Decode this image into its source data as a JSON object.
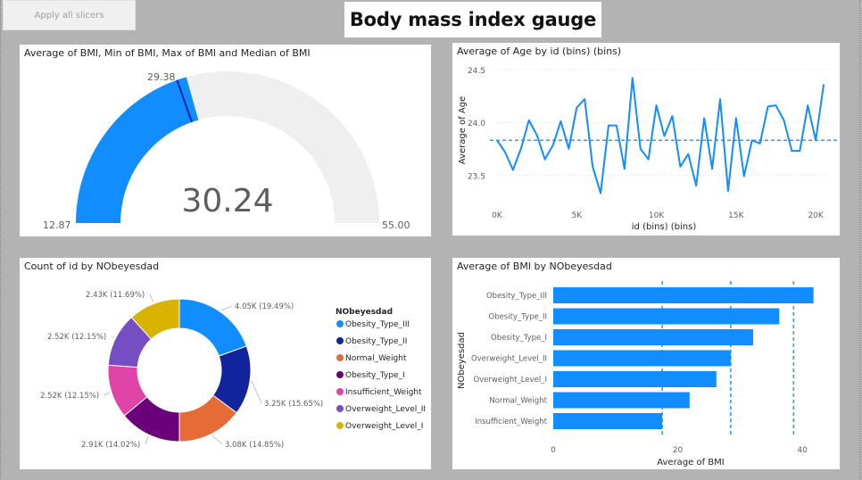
{
  "toolbar": {
    "apply_slicers_label": "Apply all slicers"
  },
  "page": {
    "title": "Body mass index gauge"
  },
  "colors": {
    "accent": "#118DFF",
    "gauge_track": "#F0EFEF",
    "target_line": "#12239E",
    "text": "#252423",
    "axis_text": "#605E5C",
    "gridline": "#E1E1E1"
  },
  "gauge": {
    "title": "Average of BMI, Min of BMI, Max of BMI and Median of BMI",
    "value": 30.24,
    "value_label": "30.24",
    "min": 12.87,
    "min_label": "12.87",
    "max": 55.0,
    "max_label": "55.00",
    "target": 29.38,
    "target_label": "29.38"
  },
  "line": {
    "title": "Average of Age by id (bins) (bins)",
    "xlabel": "id (bins) (bins)",
    "ylabel": "Average of Age",
    "xticks": [
      "0K",
      "5K",
      "10K",
      "15K",
      "20K"
    ],
    "yticks": [
      "24.5",
      "24.0",
      "23.5"
    ]
  },
  "donut": {
    "title": "Count of id by NObeyesdad",
    "legend_title": "NObeyesdad",
    "slices": [
      {
        "name": "Obesity_Type_III",
        "label": "4.05K (19.49%)",
        "value": 4050,
        "color": "#118DFF"
      },
      {
        "name": "Obesity_Type_II",
        "label": "3.25K (15.65%)",
        "value": 3250,
        "color": "#12239E"
      },
      {
        "name": "Normal_Weight",
        "label": "3.08K (14.85%)",
        "value": 3080,
        "color": "#E66C37"
      },
      {
        "name": "Obesity_Type_I",
        "label": "2.91K (14.02%)",
        "value": 2910,
        "color": "#6B007B"
      },
      {
        "name": "Insufficient_Weight",
        "label": "2.52K (12.15%)",
        "value": 2520,
        "color": "#E044A7"
      },
      {
        "name": "Overweight_Level_II",
        "label": "2.52K (12.15%)",
        "value": 2520,
        "color": "#744EC2"
      },
      {
        "name": "Overweight_Level_I",
        "label": "2.43K (11.69%)",
        "value": 2430,
        "color": "#D9B300"
      }
    ]
  },
  "bar": {
    "title": "Average of BMI by NObeyesdad",
    "xlabel": "Average of BMI",
    "ylabel": "NObeyesdad",
    "xticks": [
      "0",
      "20",
      "40"
    ]
  },
  "chart_data": [
    {
      "type": "gauge",
      "title": "Average of BMI, Min of BMI, Max of BMI and Median of BMI",
      "value": 30.24,
      "min": 12.87,
      "max": 55.0,
      "target": 29.38
    },
    {
      "type": "line",
      "title": "Average of Age by id (bins) (bins)",
      "xlabel": "id (bins) (bins)",
      "ylabel": "Average of Age",
      "xlim": [
        0,
        21000
      ],
      "ylim": [
        23.3,
        24.55
      ],
      "reference_line": 23.83,
      "x": [
        0,
        500,
        1000,
        1500,
        2000,
        2500,
        3000,
        3500,
        4000,
        4500,
        5000,
        5500,
        6000,
        6500,
        7000,
        7500,
        8000,
        8500,
        9000,
        9500,
        10000,
        10500,
        11000,
        11500,
        12000,
        12500,
        13000,
        13500,
        14000,
        14500,
        15000,
        15500,
        16000,
        16500,
        17000,
        17500,
        18000,
        18500,
        19000,
        19500,
        20000,
        20500
      ],
      "y": [
        23.83,
        23.72,
        23.55,
        23.75,
        24.02,
        23.88,
        23.65,
        23.78,
        24.01,
        23.75,
        24.14,
        24.22,
        23.58,
        23.33,
        23.97,
        23.97,
        23.56,
        24.42,
        23.75,
        23.65,
        24.16,
        23.87,
        24.06,
        23.58,
        23.7,
        23.4,
        24.04,
        23.56,
        24.22,
        23.35,
        24.04,
        23.49,
        23.83,
        23.8,
        24.15,
        24.16,
        24.02,
        23.73,
        23.73,
        24.16,
        23.83,
        24.36
      ],
      "grid": true
    },
    {
      "type": "pie",
      "title": "Count of id by NObeyesdad",
      "categories": [
        "Obesity_Type_III",
        "Obesity_Type_II",
        "Normal_Weight",
        "Obesity_Type_I",
        "Insufficient_Weight",
        "Overweight_Level_II",
        "Overweight_Level_I"
      ],
      "values": [
        4050,
        3250,
        3080,
        2910,
        2520,
        2520,
        2430
      ],
      "legend": "right"
    },
    {
      "type": "bar",
      "title": "Average of BMI by NObeyesdad",
      "orientation": "horizontal",
      "categories": [
        "Obesity_Type_III",
        "Obesity_Type_II",
        "Obesity_Type_I",
        "Overweight_Level_II",
        "Overweight_Level_I",
        "Normal_Weight",
        "Insufficient_Weight"
      ],
      "values": [
        41.8,
        36.3,
        32.1,
        28.5,
        26.2,
        21.9,
        17.5
      ],
      "xlabel": "Average of BMI",
      "ylabel": "NObeyesdad",
      "xlim": [
        0,
        44
      ],
      "reference_lines": [
        17.5,
        28.5,
        38.6
      ]
    }
  ]
}
